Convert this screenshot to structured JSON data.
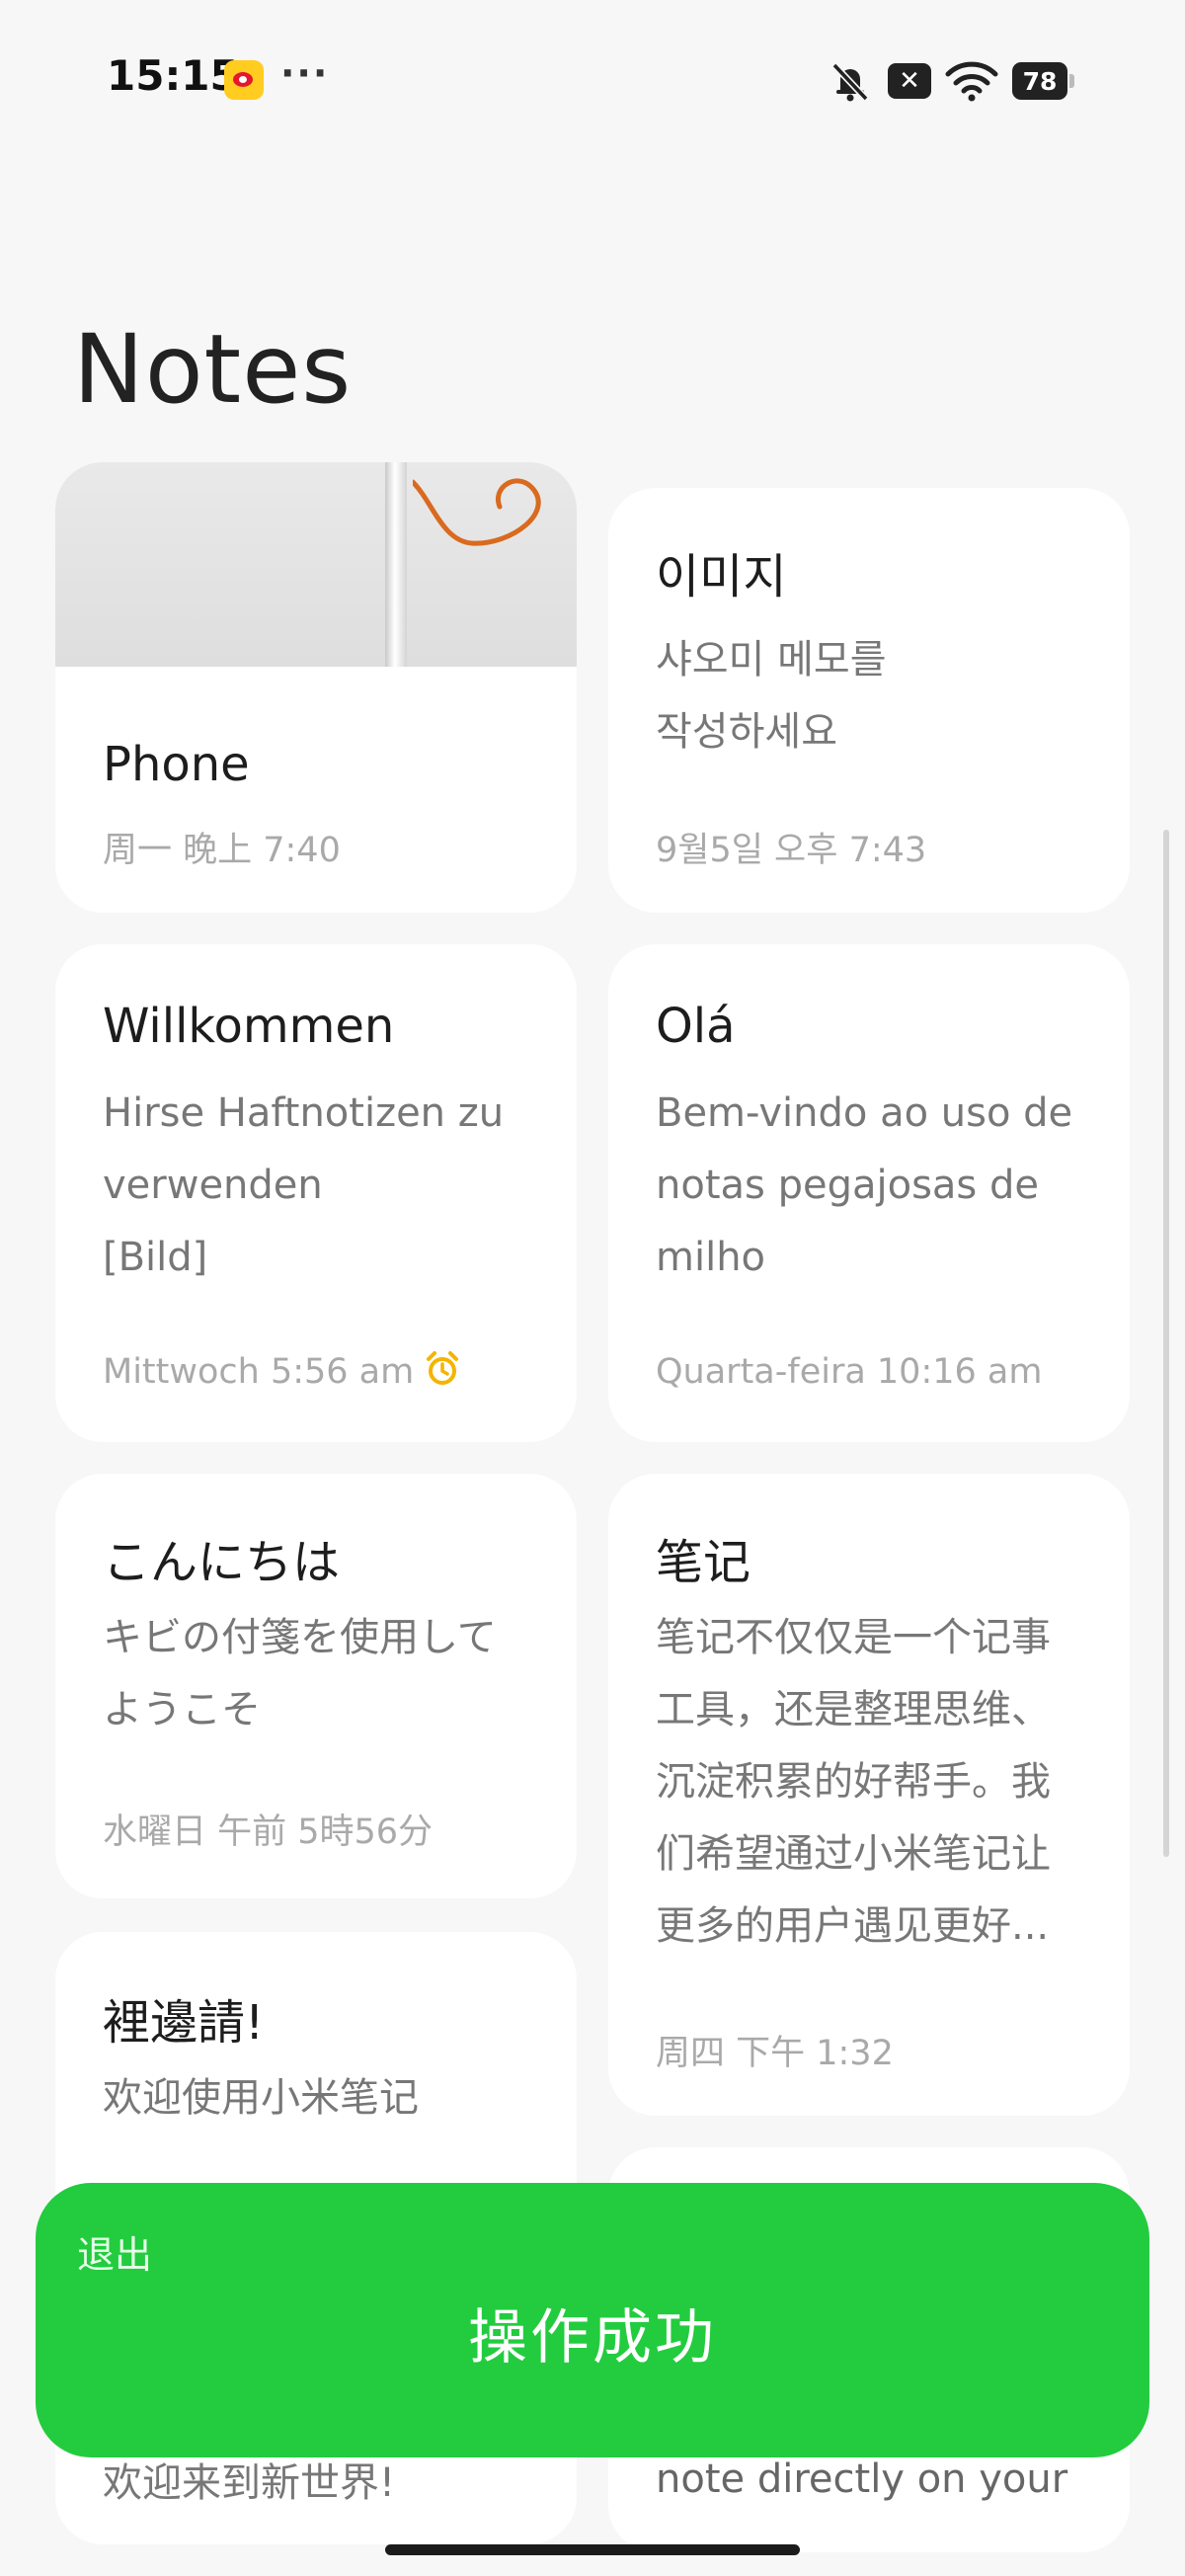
{
  "status_bar": {
    "time": "15:15",
    "more": "···",
    "battery": "78",
    "x_badge": "✕"
  },
  "header": {
    "title": "Notes"
  },
  "notes": [
    {
      "title": "Phone",
      "date": "周一 晚上 7:40",
      "has_image": true
    },
    {
      "title": "이미지",
      "body": [
        "샤오미 메모를",
        "작성하세요"
      ],
      "date": "9월5일 오후 7:43"
    },
    {
      "title": "Willkommen",
      "body": [
        "Hirse Haftnotizen zu",
        "verwenden",
        "[Bild]"
      ],
      "date": "Mittwoch 5:56 am",
      "has_alarm": true
    },
    {
      "title": "Olá",
      "body": [
        "Bem-vindo ao uso de",
        "notas pegajosas de",
        "milho"
      ],
      "date": "Quarta-feira 10:16 am"
    },
    {
      "title": "こんにちは",
      "body": [
        "キビの付箋を使用して",
        "ようこそ"
      ],
      "date": "水曜日 午前 5時56分"
    },
    {
      "title": "笔记",
      "body": [
        "笔记不仅仅是一个记事",
        "工具，还是整理思维、",
        "沉淀积累的好帮手。我",
        "们希望通过小米笔记让",
        "更多的用户遇见更好..."
      ],
      "date": "周四 下午 1:32"
    },
    {
      "title": "裡邊請!",
      "body": [
        "欢迎使用小米笔记"
      ],
      "partial_bottom": "欢迎来到新世界!"
    },
    {
      "partial_bottom": "note directly on your"
    }
  ],
  "toast": {
    "exit_label": "退出",
    "message": "操作成功"
  },
  "colors": {
    "toast": "#22cc3e",
    "alarm": "#f5b400",
    "background": "#f7f7f7"
  }
}
